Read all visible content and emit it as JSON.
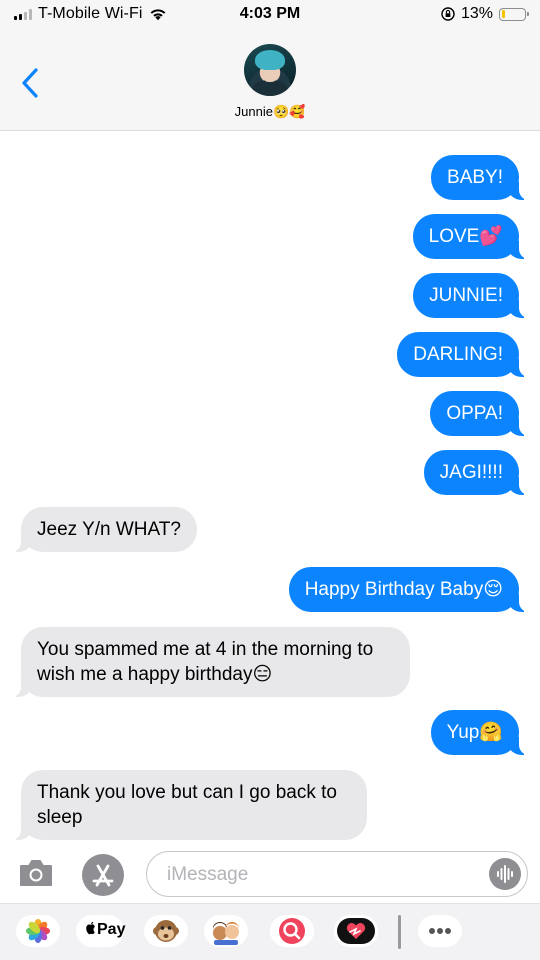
{
  "status_bar": {
    "carrier": "T-Mobile Wi-Fi",
    "time": "4:03 PM",
    "battery": "13%",
    "battery_level": 0.13
  },
  "header": {
    "contact_name": "Junnie🥺🥰"
  },
  "messages": [
    {
      "from": "me",
      "text": "BABY!"
    },
    {
      "from": "me",
      "text": "LOVE💕"
    },
    {
      "from": "me",
      "text": "JUNNIE!"
    },
    {
      "from": "me",
      "text": "DARLING!"
    },
    {
      "from": "me",
      "text": "OPPA!"
    },
    {
      "from": "me",
      "text": "JAGI!!!!"
    },
    {
      "from": "them",
      "text": "Jeez Y/n WHAT?"
    },
    {
      "from": "me",
      "text": "Happy Birthday Baby😌"
    },
    {
      "from": "them",
      "text": "You spammed me at 4 in the morning to wish me a happy birthday😑"
    },
    {
      "from": "me",
      "text": "Yup🤗"
    },
    {
      "from": "them",
      "text": "Thank you love but can I go back to sleep"
    }
  ],
  "compose": {
    "placeholder": "iMessage"
  },
  "app_drawer": {
    "apple_pay_label": "Pay"
  },
  "colors": {
    "sent_bubble": "#0b84fe",
    "received_bubble": "#e8e8ea",
    "accent": "#0b84fe"
  },
  "icons": [
    "back-chevron-icon",
    "wifi-icon",
    "orientation-lock-icon",
    "battery-icon",
    "camera-icon",
    "app-store-icon",
    "audio-waveform-icon",
    "photos-icon",
    "apple-pay-icon",
    "animoji-icon",
    "memoji-icon",
    "image-search-icon",
    "digital-touch-icon",
    "more-icon"
  ]
}
